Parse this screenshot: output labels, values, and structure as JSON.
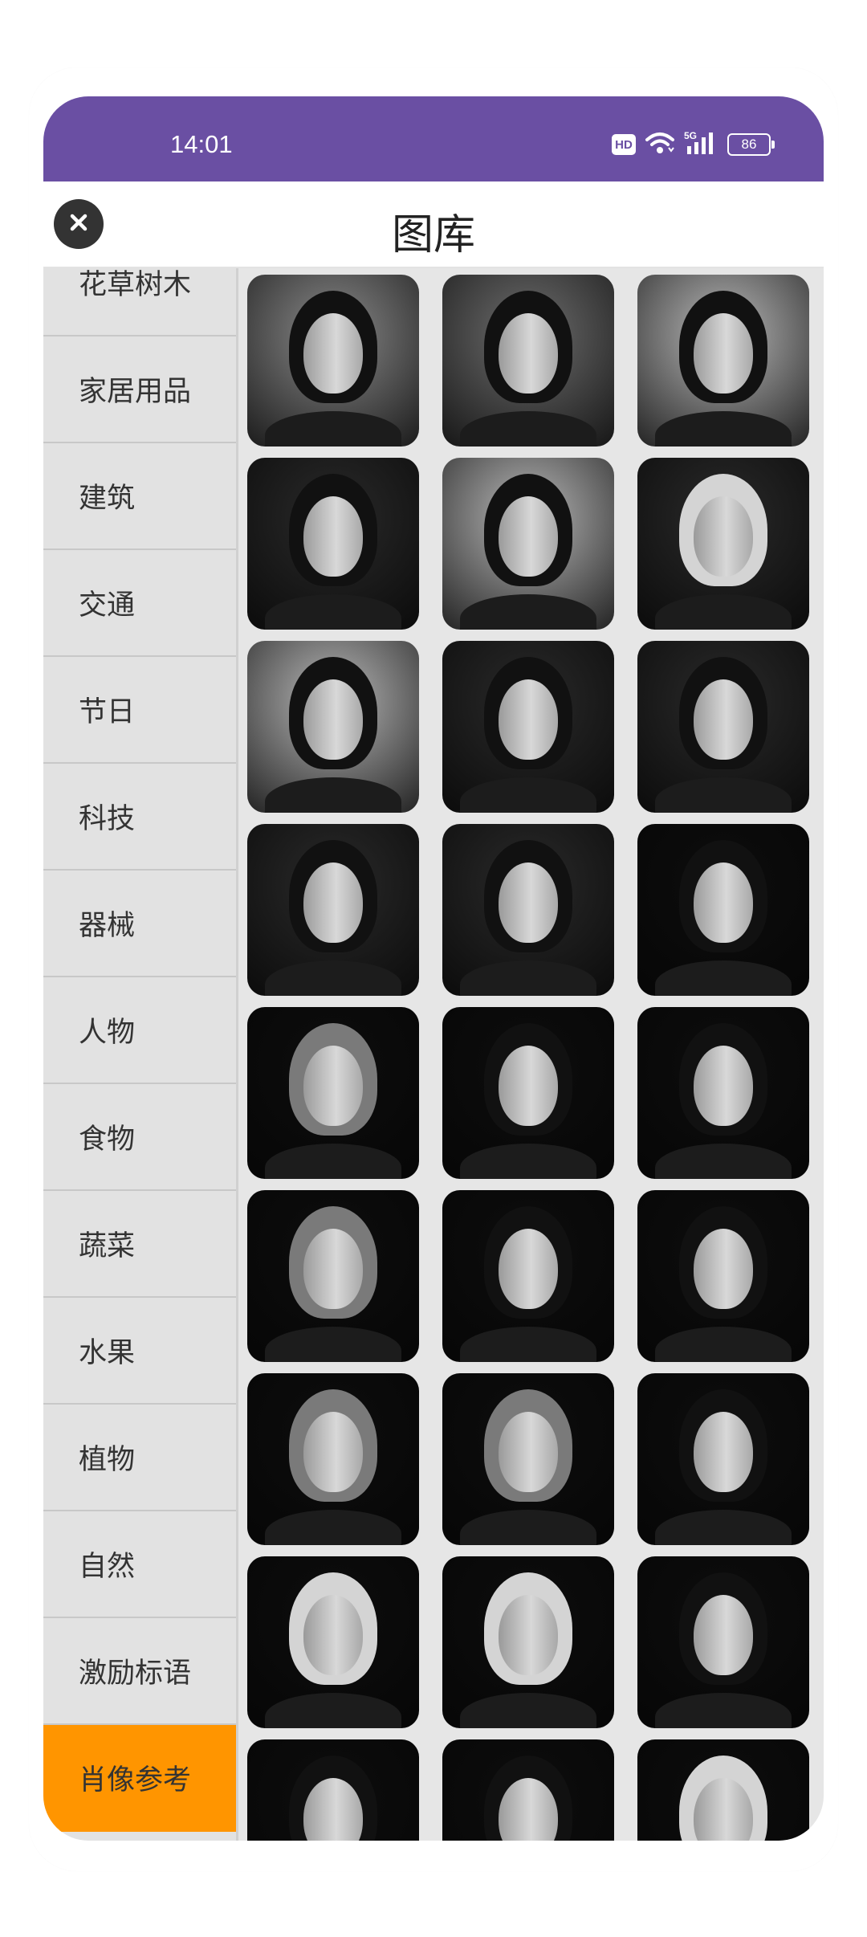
{
  "status_bar": {
    "time": "14:01",
    "hd": "HD",
    "network": "5G",
    "battery": "86",
    "background": "#6a4fa3"
  },
  "header": {
    "title": "图库",
    "close_icon": "close-icon"
  },
  "sidebar": {
    "active_color": "#ff9500",
    "items": [
      {
        "label": "花草树木",
        "active": false
      },
      {
        "label": "家居用品",
        "active": false
      },
      {
        "label": "建筑",
        "active": false
      },
      {
        "label": "交通",
        "active": false
      },
      {
        "label": "节日",
        "active": false
      },
      {
        "label": "科技",
        "active": false
      },
      {
        "label": "器械",
        "active": false
      },
      {
        "label": "人物",
        "active": false
      },
      {
        "label": "食物",
        "active": false
      },
      {
        "label": "蔬菜",
        "active": false
      },
      {
        "label": "水果",
        "active": false
      },
      {
        "label": "植物",
        "active": false
      },
      {
        "label": "自然",
        "active": false
      },
      {
        "label": "激励标语",
        "active": false
      },
      {
        "label": "肖像参考",
        "active": true
      }
    ]
  },
  "gallery": {
    "columns": 3,
    "photos": [
      {
        "tone": "bright",
        "hair": "dark"
      },
      {
        "tone": "mid",
        "hair": "dark"
      },
      {
        "tone": "light",
        "hair": "dark"
      },
      {
        "tone": "dark",
        "hair": "dark"
      },
      {
        "tone": "light",
        "hair": "dark"
      },
      {
        "tone": "dark",
        "hair": "white"
      },
      {
        "tone": "light",
        "hair": "dark"
      },
      {
        "tone": "dark",
        "hair": "dark"
      },
      {
        "tone": "dark",
        "hair": "dark"
      },
      {
        "tone": "dark",
        "hair": "dark"
      },
      {
        "tone": "dark",
        "hair": "dark"
      },
      {
        "tone": "black",
        "hair": "dark"
      },
      {
        "tone": "black",
        "hair": "gray"
      },
      {
        "tone": "black",
        "hair": "dark"
      },
      {
        "tone": "black",
        "hair": "dark"
      },
      {
        "tone": "black",
        "hair": "gray"
      },
      {
        "tone": "black",
        "hair": "dark"
      },
      {
        "tone": "black",
        "hair": "dark"
      },
      {
        "tone": "black",
        "hair": "gray"
      },
      {
        "tone": "black",
        "hair": "gray"
      },
      {
        "tone": "black",
        "hair": "dark"
      },
      {
        "tone": "black",
        "hair": "white"
      },
      {
        "tone": "black",
        "hair": "white"
      },
      {
        "tone": "black",
        "hair": "dark"
      },
      {
        "tone": "black",
        "hair": "dark"
      },
      {
        "tone": "black",
        "hair": "dark"
      },
      {
        "tone": "black",
        "hair": "white"
      }
    ]
  }
}
